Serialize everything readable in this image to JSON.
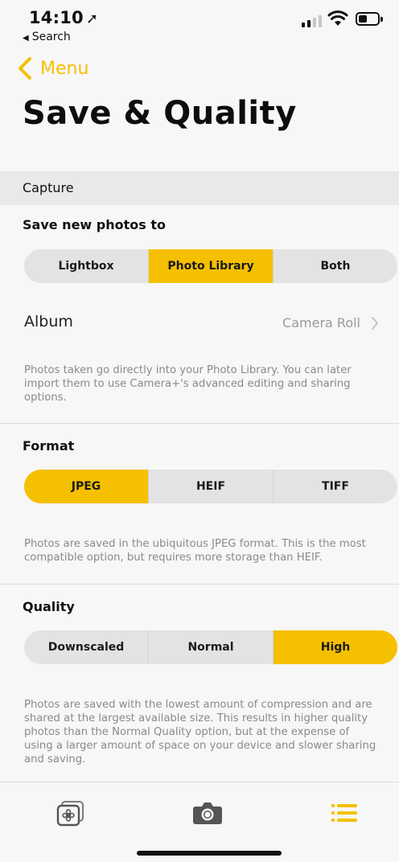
{
  "status_bar": {
    "time": "14:10",
    "back_app": "Search"
  },
  "nav": {
    "back_label": "Menu"
  },
  "page_title": "Save & Quality",
  "capture_section": {
    "header": "Capture",
    "save_to": {
      "label": "Save new photos to",
      "options": [
        "Lightbox",
        "Photo Library",
        "Both"
      ],
      "selected": "Photo Library"
    },
    "album": {
      "label": "Album",
      "value": "Camera Roll"
    },
    "save_description": "Photos taken go directly into your Photo Library. You can later import them to use Camera+'s advanced editing and sharing options."
  },
  "format": {
    "label": "Format",
    "options": [
      "JPEG",
      "HEIF",
      "TIFF"
    ],
    "selected": "JPEG",
    "description": "Photos are saved in the ubiquitous JPEG format. This is the most compatible option, but requires more storage than HEIF."
  },
  "quality": {
    "label": "Quality",
    "options": [
      "Downscaled",
      "Normal",
      "High"
    ],
    "selected": "High",
    "description": "Photos are saved with the lowest amount of compression and are shared at the largest available size. This results in higher quality photos than the Normal Quality option, but at the expense of using a larger amount of space on your device and slower sharing and saving."
  },
  "tab_bar": {
    "items": [
      {
        "icon": "lightbox-icon",
        "active": false
      },
      {
        "icon": "camera-icon",
        "active": false
      },
      {
        "icon": "menu-list-icon",
        "active": true
      }
    ]
  },
  "colors": {
    "accent": "#f5c000",
    "segment_bg": "#e3e3e3",
    "section_header_bg": "#e9e9e9"
  }
}
